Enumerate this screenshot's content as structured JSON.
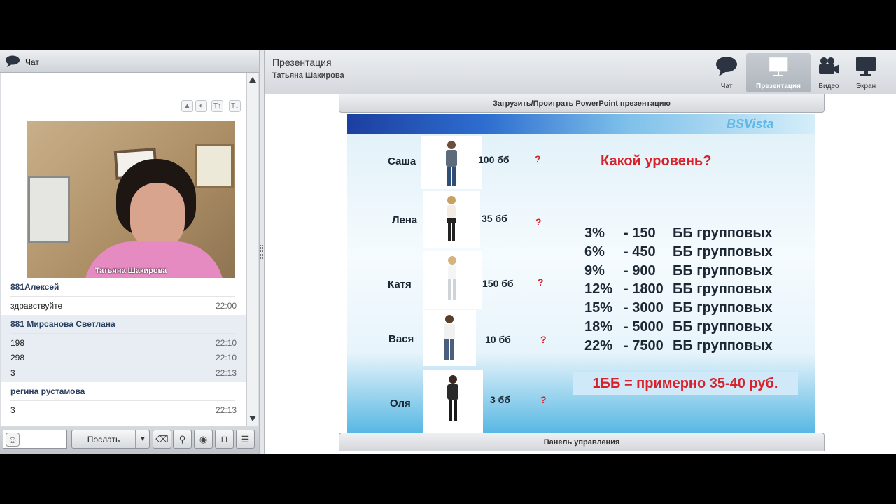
{
  "chat": {
    "title": "Чат",
    "video_caption": "Татьяна Шакирова",
    "messages": [
      {
        "author": "881Алексей",
        "lines": [
          {
            "text": "здравствуйте",
            "time": "22:00"
          }
        ]
      },
      {
        "author": "881 Мирсанова Светлана",
        "lines": [
          {
            "text": "198",
            "time": "22:10"
          },
          {
            "text": "298",
            "time": "22:10"
          },
          {
            "text": "3",
            "time": "22:13"
          }
        ]
      },
      {
        "author": "регина рустамова",
        "lines": [
          {
            "text": "3",
            "time": "22:13"
          }
        ]
      }
    ],
    "send_label": "Послать"
  },
  "presentation": {
    "title": "Презентация",
    "subtitle": "Татьяна Шакирова",
    "modes": {
      "chat": "Чат",
      "presentation": "Презентация",
      "video": "Видео",
      "screen": "Экран"
    },
    "top_tab": "Загрузить/Проиграть PowerPoint презентацию",
    "bottom_tab": "Панель управления"
  },
  "slide": {
    "logo": "BSVista",
    "heading": "Какой уровень?",
    "people": [
      {
        "name": "Саша",
        "points": "100 бб",
        "mark": "?"
      },
      {
        "name": "Лена",
        "points": "35 бб",
        "mark": "?"
      },
      {
        "name": "Катя",
        "points": "150 бб",
        "mark": "?"
      },
      {
        "name": "Вася",
        "points": "10 бб",
        "mark": "?"
      },
      {
        "name": "Оля",
        "points": "3 бб",
        "mark": "?"
      }
    ],
    "levels": [
      {
        "pct": "3%",
        "value": "- 150",
        "unit": "ББ групповых"
      },
      {
        "pct": "6%",
        "value": "- 450",
        "unit": "ББ групповых"
      },
      {
        "pct": "9%",
        "value": "- 900",
        "unit": "ББ групповых"
      },
      {
        "pct": "12%",
        "value": "- 1800",
        "unit": "ББ групповых"
      },
      {
        "pct": "15%",
        "value": "- 3000",
        "unit": "ББ групповых"
      },
      {
        "pct": "18%",
        "value": "- 5000",
        "unit": "ББ групповых"
      },
      {
        "pct": "22%",
        "value": "- 7500",
        "unit": "ББ групповых"
      }
    ],
    "note": "1ББ = примерно 35-40 руб."
  },
  "colors": {
    "accent_red": "#d8222b",
    "panel_bg": "#d9dde2",
    "chat_author": "#2a3f5f"
  }
}
